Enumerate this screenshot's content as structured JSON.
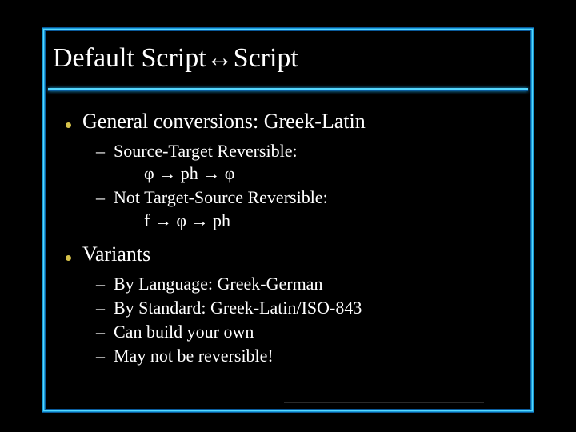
{
  "title": "Default Script↔Script",
  "bullets": [
    {
      "label": "General conversions: Greek-Latin",
      "sub": [
        {
          "label": "Source-Target Reversible:",
          "detail": "φ → ph → φ"
        },
        {
          "label": "Not Target-Source Reversible:",
          "detail": "f → φ → ph"
        }
      ]
    },
    {
      "label": "Variants",
      "sub": [
        {
          "label": "By Language: Greek-German"
        },
        {
          "label": "By Standard: Greek-Latin/ISO-843"
        },
        {
          "label": "Can build your own"
        },
        {
          "label": "May not be reversible!"
        }
      ]
    }
  ]
}
